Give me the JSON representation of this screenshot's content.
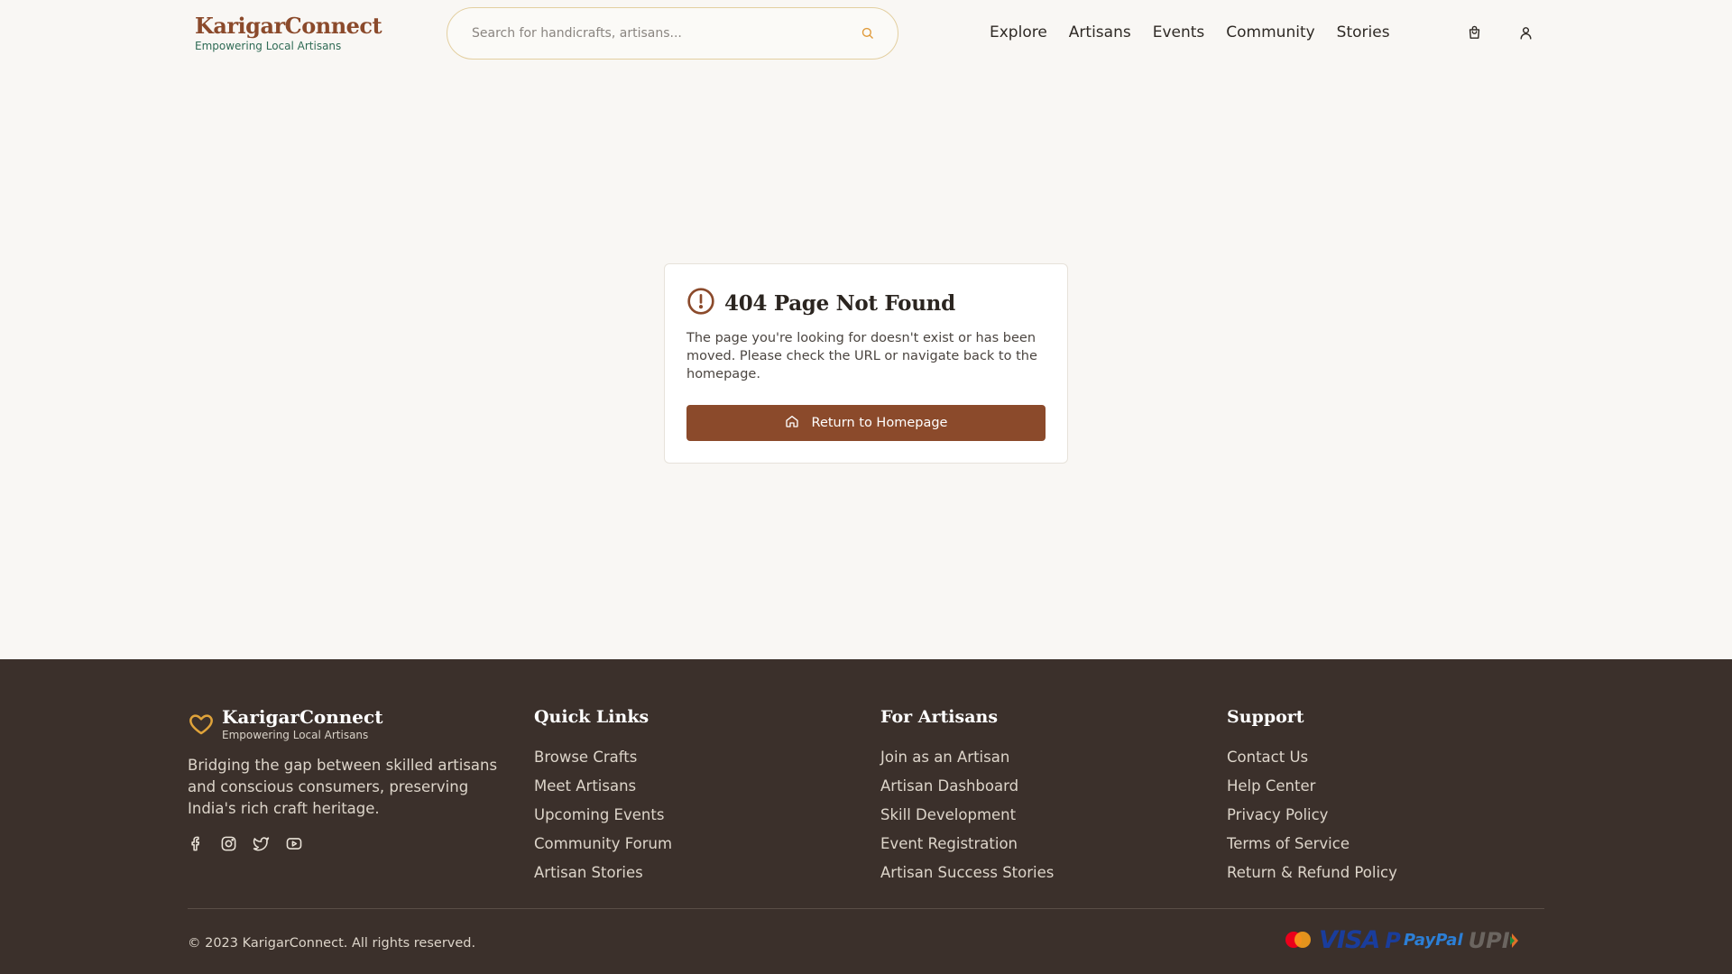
{
  "header": {
    "logo_title": "KarigarConnect",
    "logo_subtitle": "Empowering Local Artisans",
    "search_placeholder": "Search for handicrafts, artisans...",
    "nav": [
      "Explore",
      "Artisans",
      "Events",
      "Community",
      "Stories"
    ],
    "icons": [
      "search-icon",
      "cart-icon",
      "user-icon"
    ]
  },
  "error_card": {
    "title": "404 Page Not Found",
    "message": "The page you're looking for doesn't exist or has been moved. Please check the URL or navigate back to the homepage.",
    "button_label": "Return to Homepage",
    "icons": [
      "alert-circle-icon",
      "home-icon"
    ]
  },
  "footer": {
    "brand_title": "KarigarConnect",
    "brand_subtitle": "Empowering Local Artisans",
    "description": "Bridging the gap between skilled artisans and conscious consumers, preserving India's rich craft heritage.",
    "social": [
      "facebook-icon",
      "instagram-icon",
      "twitter-icon",
      "youtube-icon"
    ],
    "columns": [
      {
        "title": "Quick Links",
        "links": [
          "Browse Crafts",
          "Meet Artisans",
          "Upcoming Events",
          "Community Forum",
          "Artisan Stories"
        ]
      },
      {
        "title": "For Artisans",
        "links": [
          "Join as an Artisan",
          "Artisan Dashboard",
          "Skill Development",
          "Event Registration",
          "Artisan Success Stories"
        ]
      },
      {
        "title": "Support",
        "links": [
          "Contact Us",
          "Help Center",
          "Privacy Policy",
          "Terms of Service",
          "Return & Refund Policy"
        ]
      }
    ],
    "copyright": "© 2023 KarigarConnect. All rights reserved.",
    "payment_logos": [
      "Mastercard",
      "VISA",
      "PayPal",
      "UPI"
    ]
  },
  "colors": {
    "brand_brown": "#8b4a2b",
    "brand_green": "#2f6b55",
    "footer_bg": "#3b302b",
    "accent_gold": "#e0a33a",
    "page_bg": "#f9f7f4"
  }
}
